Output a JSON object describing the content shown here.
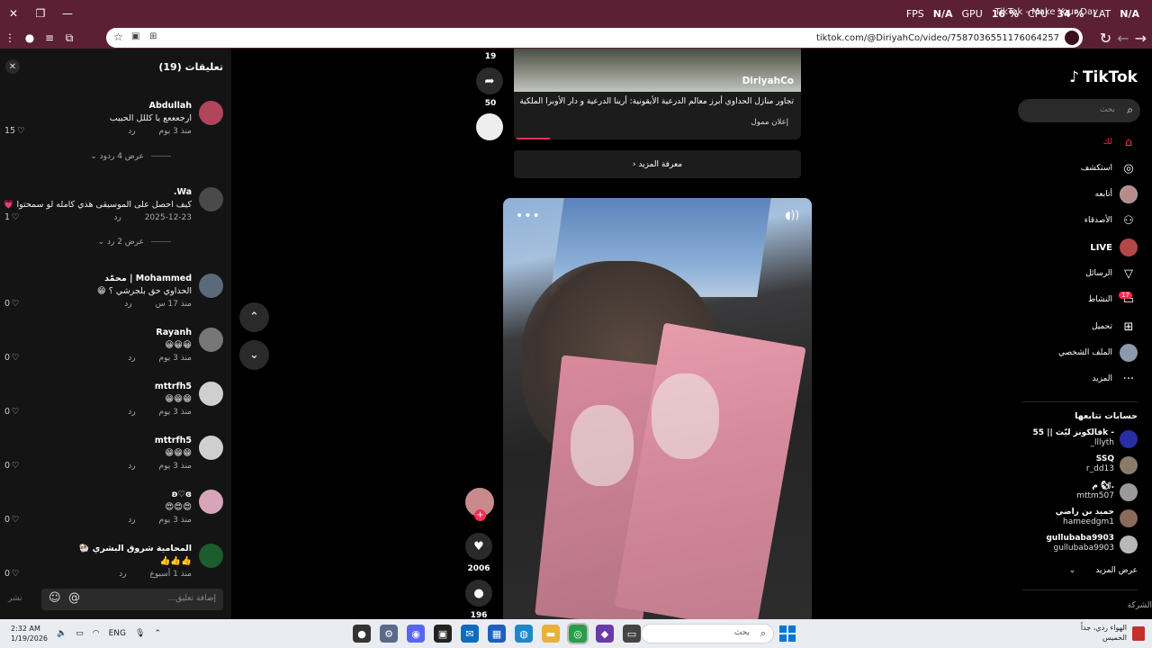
{
  "browser": {
    "tab_title": "TikTok - Make Your Day",
    "url": "tiktok.com/@DiriyahCo/video/7587036551176064257",
    "overlay": {
      "fps_label": "FPS",
      "fps_value": "N/A",
      "gpu_label": "GPU",
      "gpu_value": "16 %",
      "cpu_label": "CPU",
      "cpu_value": "34 %",
      "lat_label": "LAT",
      "lat_value": "N/A"
    }
  },
  "comments": {
    "title": "تعليقات (19)",
    "input_placeholder": "إضافة تعليق...",
    "post_label": "نشر",
    "items": [
      {
        "name": "Abdullah",
        "text": "ارجعععع يا كللل الحبيب",
        "time": "منذ 3 يوم",
        "reply": "رد",
        "likes": "15",
        "avatar": "#b0455b"
      },
      {
        "name": "Wa.",
        "text": "كيف احصل على الموسيقى هذي كامله لو سمحتوا 💗",
        "time": "2025-12-23",
        "reply": "رد",
        "likes": "1",
        "avatar": "#4a4a4a"
      },
      {
        "name": "Mohammed | محمّد",
        "text": "الحداوي حق بلجرشي ؟ 😁",
        "time": "منذ 17 س",
        "reply": "رد",
        "likes": "0",
        "avatar": "#5a6a7a"
      },
      {
        "name": "Rayanh",
        "text": "😀😀😀",
        "time": "منذ 3 يوم",
        "reply": "رد",
        "likes": "0",
        "avatar": "#777"
      },
      {
        "name": "mttrfh5",
        "text": "😁😁😁",
        "time": "منذ 3 يوم",
        "reply": "رد",
        "likes": "0",
        "avatar": "#cfcfcf"
      },
      {
        "name": "mttrfh5",
        "text": "😁😁😁",
        "time": "منذ 3 يوم",
        "reply": "رد",
        "likes": "0",
        "avatar": "#cfcfcf"
      },
      {
        "name": "ʚ♡ɞ",
        "text": "😍😍😍",
        "time": "منذ 3 يوم",
        "reply": "رد",
        "likes": "0",
        "avatar": "#d6a6b8"
      },
      {
        "name": "المحامية شروق البشري 🐏",
        "text": "👍👍👍",
        "time": "منذ 1 أسبوع",
        "reply": "رد",
        "likes": "0",
        "avatar": "#1d5c2c"
      }
    ],
    "replies_1": "عرض 4 ردود",
    "replies_2": "عرض 2 رد"
  },
  "feed": {
    "share_count_top": "19",
    "share_count": "50",
    "ad_brand": "DiriyahCo",
    "ad_description": "تجاور منازل الحداوي أبرز معالم الدرعية الأيقونية: أرينا الدرعية و دار الأوبرا الملكية",
    "ad_sponsored": "إعلان ممول",
    "learn_more": "معرفة المزيد",
    "like_count": "2006",
    "comment_count": "196"
  },
  "sidebar": {
    "logo": "TikTok",
    "search_placeholder": "بحث",
    "nav": [
      {
        "label": "لك",
        "icon": "home-icon"
      },
      {
        "label": "استكشف",
        "icon": "compass-icon"
      },
      {
        "label": "أتابعه",
        "icon": "following-icon"
      },
      {
        "label": "الأصدقاء",
        "icon": "friends-icon"
      },
      {
        "label": "LIVE",
        "icon": "live-icon"
      },
      {
        "label": "الرسائل",
        "icon": "send-icon"
      },
      {
        "label": "النشاط",
        "icon": "activity-icon"
      },
      {
        "label": "تحميل",
        "icon": "upload-icon"
      },
      {
        "label": "الملف الشخصي",
        "icon": "profile-icon"
      },
      {
        "label": "المزيد",
        "icon": "more-icon"
      }
    ],
    "activity_badge": "17",
    "following_title": "حسابات تتابعها",
    "following": [
      {
        "name": "فالكونز ليّث || 55k -",
        "handle": "_lllyth",
        "avatar": "#2a2ea5"
      },
      {
        "name": "SSQ",
        "handle": "r_dd13",
        "avatar": "#8a7a6a"
      },
      {
        "name": "م 🐿.",
        "handle": "mttm507",
        "avatar": "#9a9a9a"
      },
      {
        "name": "حميد بن راضي",
        "handle": "hameedgm1",
        "avatar": "#8a6a5a"
      },
      {
        "name": "gullubaba9903",
        "handle": "gullubaba9903",
        "avatar": "#b8b8b8"
      }
    ],
    "see_more": "عرض المزيد",
    "company": "الشركة"
  },
  "taskbar": {
    "time": "2:32 AM",
    "date": "1/19/2026",
    "lang": "ENG",
    "search_placeholder": "بحث",
    "weather_line1": "الهواء ردي، جداً",
    "weather_line2": "الخميس"
  }
}
